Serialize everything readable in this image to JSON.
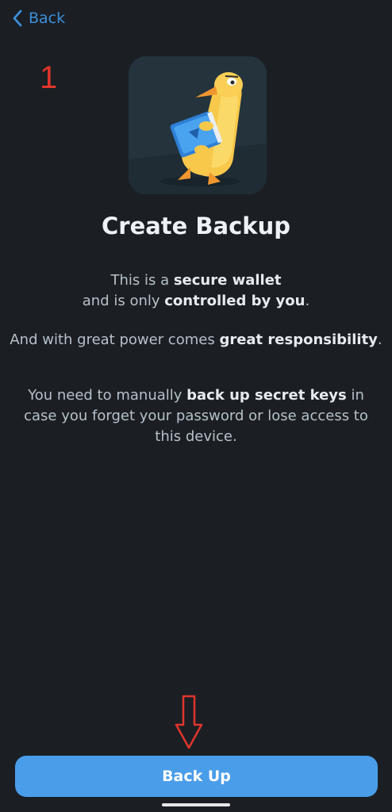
{
  "nav": {
    "back_label": "Back"
  },
  "annotation": {
    "step_number": "1"
  },
  "header": {
    "title": "Create Backup"
  },
  "description": {
    "p1": {
      "line1_pre": "This is a ",
      "line1_bold": "secure wallet",
      "line2_pre": "and is only ",
      "line2_bold": "controlled by you",
      "line2_post": "."
    },
    "p2": {
      "pre": "And with great power comes ",
      "bold": "great responsibility",
      "post": "."
    },
    "p3": {
      "pre": "You need to manually ",
      "bold": "back up secret keys",
      "post": " in case you forget your password or lose access to this device."
    }
  },
  "actions": {
    "primary_label": "Back Up"
  },
  "colors": {
    "background": "#1b1f24",
    "accent": "#4a9de8",
    "annotation": "#e0352b"
  }
}
